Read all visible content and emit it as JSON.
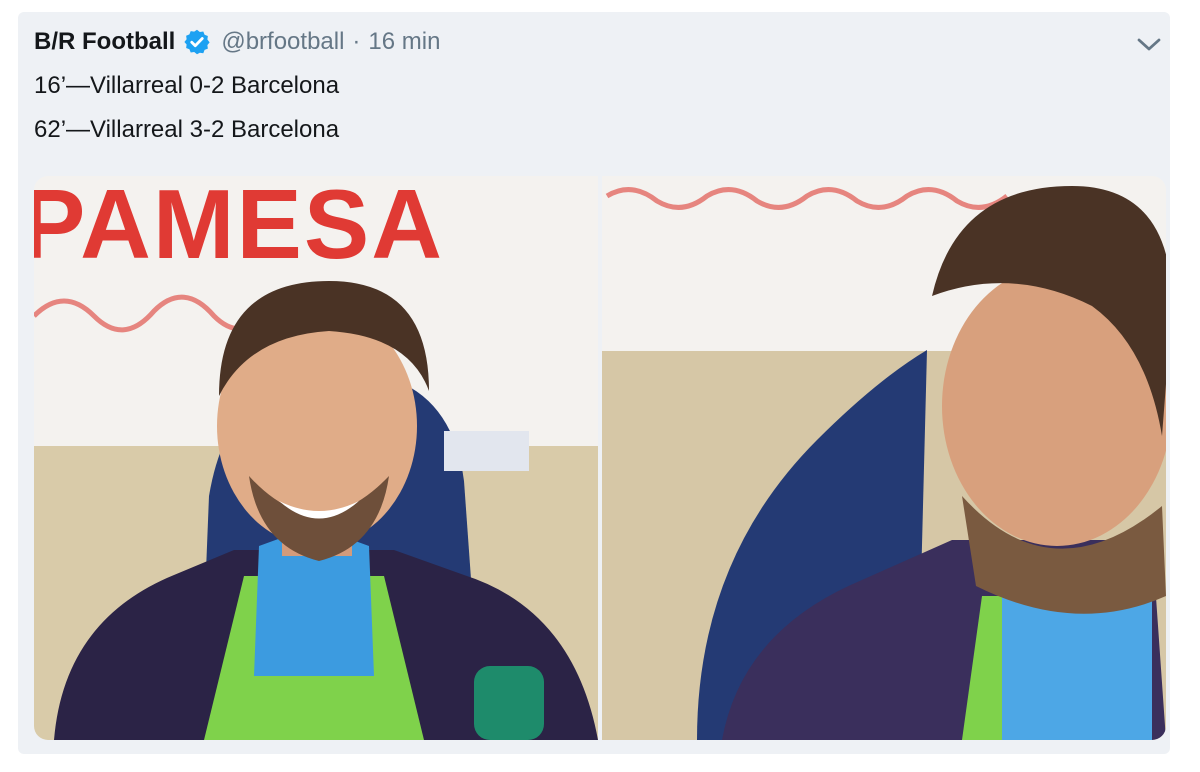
{
  "tweet": {
    "author_name": "B/R Football",
    "handle": "@brfootball",
    "separator": "·",
    "time_ago": "16 min",
    "lines": [
      "16’—Villarreal 0-2 Barcelona",
      "62’—Villarreal 3-2 Barcelona"
    ]
  },
  "media": {
    "left_banner_text": "PAMESA"
  },
  "colors": {
    "verified": "#1da1f2",
    "handle": "#657786",
    "text": "#14171a"
  },
  "icons": {
    "verified": "verified-badge-icon",
    "menu": "chevron-down-icon"
  }
}
